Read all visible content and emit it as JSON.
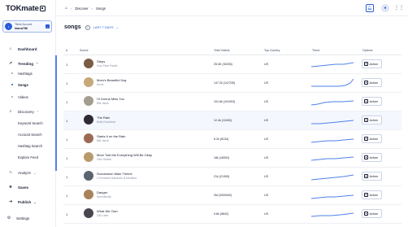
{
  "brand": {
    "logo_text": "TOKmate"
  },
  "account": {
    "line1": "Tiktok Account",
    "line2": "kiana786"
  },
  "nav": {
    "dashboard": "Dashboard",
    "trending": "Trending",
    "hashtags": "Hashtags",
    "songs": "Songs",
    "videos": "Videos",
    "discovery": "Discovery",
    "keyword_search": "Keyword Search",
    "account_search": "Account Search",
    "hashtag_search": "Hashtag Search",
    "explore_feed": "Explore Feed",
    "analyze": "Analyze",
    "saves": "Saves",
    "publish": "Publish",
    "settings": "Settings"
  },
  "breadcrumb": {
    "items": [
      "Discover",
      "Songs"
    ]
  },
  "page": {
    "title": "songs",
    "period": "LAST 7 DAYS"
  },
  "table": {
    "headers": {
      "rank": "#",
      "sound": "Sound",
      "videos": "Total Videos",
      "country": "Top Country",
      "trend": "Trend",
      "options": "Options"
    },
    "action_label": "Action",
    "rows": [
      {
        "rank": "1",
        "name": "Steps",
        "artist": "Your Pace Pacific",
        "videos": "25.3K (30235)",
        "country": "US"
      },
      {
        "rank": "1",
        "name": "Mom's Beautiful Day",
        "artist": "Arcos",
        "videos": "147.2k (147235)",
        "country": "US"
      },
      {
        "rank": "1",
        "name": "I'll Gonna Miss You",
        "artist": "Billi Jacob",
        "videos": "101.8k (101903)",
        "country": "US"
      },
      {
        "rank": "1",
        "name": "The Rain",
        "artist": "Bella Downbeat",
        "videos": "12.4k (12400)",
        "country": "US"
      },
      {
        "rank": "1",
        "name": "Starts It on the Rain",
        "artist": "Billi Jacob",
        "videos": "8.2k (8134)",
        "country": "US"
      },
      {
        "rank": "1",
        "name": "Mom Told Me Everything Will Be Okay",
        "artist": "Glen Starkin",
        "videos": "18k (18302)",
        "country": "US"
      },
      {
        "rank": "1",
        "name": "Succession Main Theme",
        "artist": "L'Orchestra Nationale di Meridina",
        "videos": "21k (21305)",
        "country": "US"
      },
      {
        "rank": "1",
        "name": "Danger",
        "artist": "Stormifactfa",
        "videos": "2M (2000000)",
        "country": "US"
      },
      {
        "rank": "1",
        "name": "What We Own",
        "artist": "Gila Larte",
        "videos": "9.8k (9842)",
        "country": "US"
      }
    ]
  },
  "colors": {
    "accent": "#2a5bd7",
    "trend_line": "#4f82ea"
  }
}
